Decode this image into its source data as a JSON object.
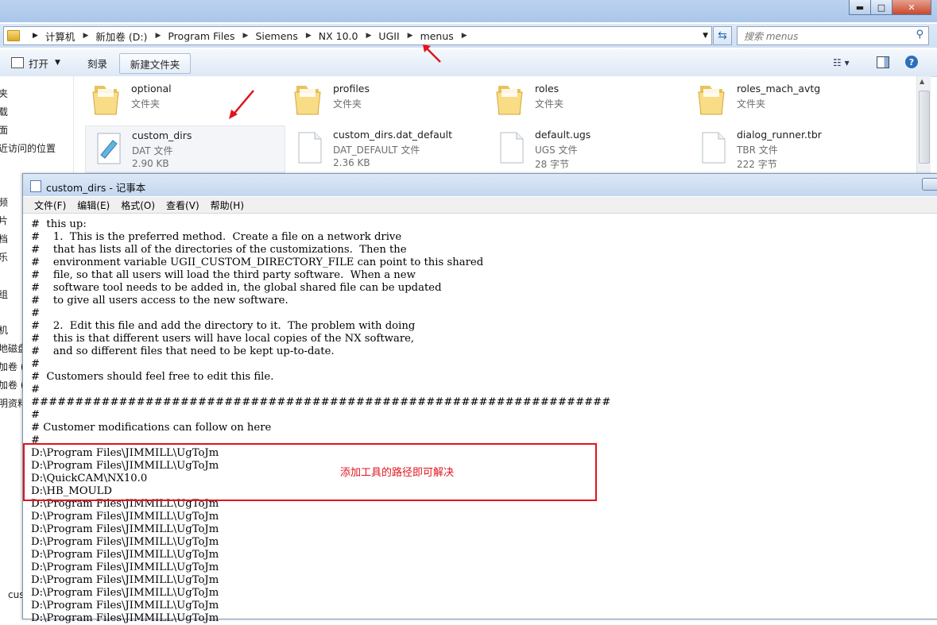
{
  "explorer": {
    "breadcrumb": [
      "计算机",
      "新加卷 (D:)",
      "Program Files",
      "Siemens",
      "NX 10.0",
      "UGII",
      "menus"
    ],
    "search_placeholder": "搜索 menus",
    "toolbar": {
      "open": "打开",
      "burn": "刻录",
      "new_folder": "新建文件夹"
    },
    "nav_items": [
      "夹",
      "载",
      "面",
      "近访问的位置",
      "频",
      "片",
      "档",
      "乐",
      "组",
      "机",
      "地磁盘",
      "加卷 (",
      "加卷 (",
      "明资料",
      "cus"
    ],
    "files": [
      {
        "name": "optional",
        "type": "文件夹",
        "size": "",
        "icon": "folder-icon"
      },
      {
        "name": "profiles",
        "type": "文件夹",
        "size": "",
        "icon": "folder-icon"
      },
      {
        "name": "roles",
        "type": "文件夹",
        "size": "",
        "icon": "folder-icon"
      },
      {
        "name": "roles_mach_avtg",
        "type": "文件夹",
        "size": "",
        "icon": "folder-icon"
      },
      {
        "name": "custom_dirs",
        "type": "DAT 文件",
        "size": "2.90 KB",
        "icon": "notepad-doc-icon"
      },
      {
        "name": "custom_dirs.dat_default",
        "type": "DAT_DEFAULT 文件",
        "size": "2.36 KB",
        "icon": "doc-icon"
      },
      {
        "name": "default.ugs",
        "type": "UGS 文件",
        "size": "28 字节",
        "icon": "doc-icon"
      },
      {
        "name": "dialog_runner.tbr",
        "type": "TBR 文件",
        "size": "222 字节",
        "icon": "doc-icon"
      }
    ]
  },
  "notepad": {
    "title": "custom_dirs - 记事本",
    "menu": [
      "文件(F)",
      "编辑(E)",
      "格式(O)",
      "查看(V)",
      "帮助(H)"
    ],
    "lines": [
      "#  this up:",
      "#    1.  This is the preferred method.  Create a file on a network drive",
      "#    that has lists all of the directories of the customizations.  Then the",
      "#    environment variable UGII_CUSTOM_DIRECTORY_FILE can point to this shared",
      "#    file, so that all users will load the third party software.  When a new",
      "#    software tool needs to be added in, the global shared file can be updated",
      "#    to give all users access to the new software.",
      "#",
      "#    2.  Edit this file and add the directory to it.  The problem with doing",
      "#    this is that different users will have local copies of the NX software,",
      "#    and so different files that need to be kept up-to-date.",
      "#",
      "#  Customers should feel free to edit this file.",
      "#",
      "##################################################################",
      "#",
      "# Customer modifications can follow on here",
      "#",
      "D:\\Program Files\\JIMMILL\\UgToJm",
      "D:\\Program Files\\JIMMILL\\UgToJm",
      "D:\\QuickCAM\\NX10.0",
      "D:\\HB_MOULD",
      "D:\\Program Files\\JIMMILL\\UgToJm",
      "D:\\Program Files\\JIMMILL\\UgToJm",
      "D:\\Program Files\\JIMMILL\\UgToJm",
      "D:\\Program Files\\JIMMILL\\UgToJm",
      "D:\\Program Files\\JIMMILL\\UgToJm",
      "D:\\Program Files\\JIMMILL\\UgToJm",
      "D:\\Program Files\\JIMMILL\\UgToJm",
      "D:\\Program Files\\JIMMILL\\UgToJm",
      "D:\\Program Files\\JIMMILL\\UgToJm",
      "D:\\Program Files\\JIMMILL\\UgToJm"
    ]
  },
  "annotation": {
    "note": "添加工具的路径即可解决",
    "color": "#e0141e"
  }
}
